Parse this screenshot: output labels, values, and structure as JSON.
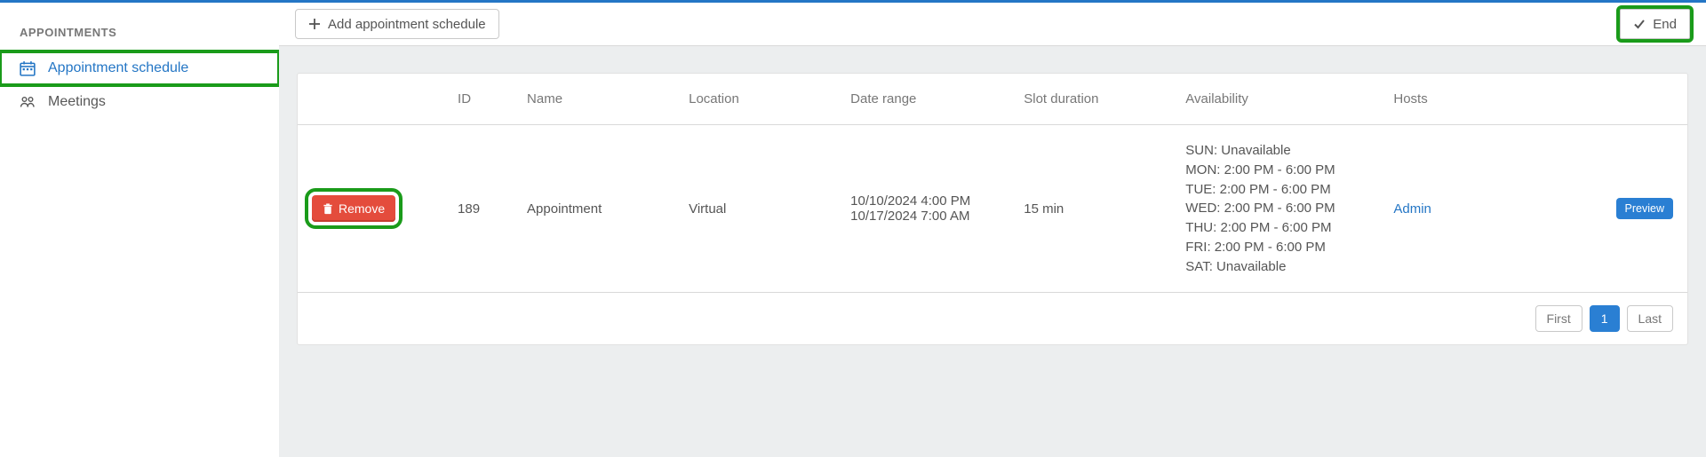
{
  "sidebar": {
    "heading": "APPOINTMENTS",
    "items": [
      {
        "label": "Appointment schedule"
      },
      {
        "label": "Meetings"
      }
    ]
  },
  "toolbar": {
    "add_label": "Add appointment schedule",
    "end_label": "End"
  },
  "table": {
    "headers": {
      "id": "ID",
      "name": "Name",
      "location": "Location",
      "date_range": "Date range",
      "slot_duration": "Slot duration",
      "availability": "Availability",
      "hosts": "Hosts"
    },
    "rows": [
      {
        "remove_label": "Remove",
        "id": "189",
        "name": "Appointment",
        "location": "Virtual",
        "date_range_line1": "10/10/2024 4:00 PM",
        "date_range_line2": "10/17/2024 7:00 AM",
        "slot_duration": "15 min",
        "availability": {
          "sun": "SUN: Unavailable",
          "mon": "MON: 2:00 PM - 6:00 PM",
          "tue": "TUE: 2:00 PM - 6:00 PM",
          "wed": "WED: 2:00 PM - 6:00 PM",
          "thu": "THU: 2:00 PM - 6:00 PM",
          "fri": "FRI: 2:00 PM - 6:00 PM",
          "sat": "SAT: Unavailable"
        },
        "host": "Admin",
        "preview_label": "Preview"
      }
    ],
    "pager": {
      "first": "First",
      "page1": "1",
      "last": "Last"
    }
  }
}
